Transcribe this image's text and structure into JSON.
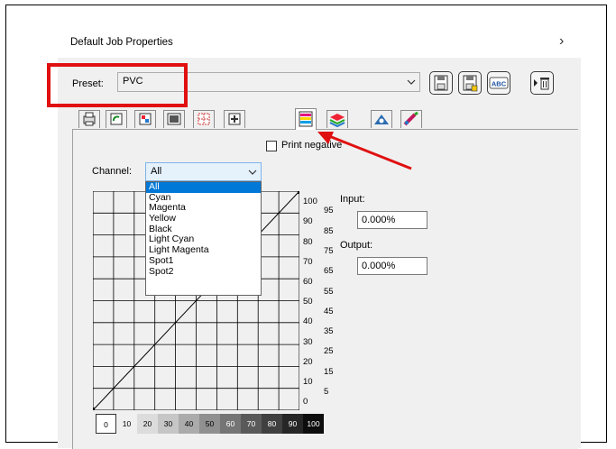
{
  "window": {
    "title": "Default Job Properties",
    "close_glyph": "›"
  },
  "preset": {
    "label": "Preset:",
    "value": "PVC"
  },
  "toolbar_icons": [
    "save-icon",
    "save-as-icon",
    "rename-icon",
    "delete-icon"
  ],
  "toolbar_labels": {
    "rename": "ABC"
  },
  "tabs": [
    "print-settings-icon",
    "rotate-icon",
    "color-icon",
    "layout-icon",
    "crop-marks-icon",
    "position-icon",
    "color-curve-icon",
    "layers-icon",
    "shape-icon",
    "color-picker-icon"
  ],
  "active_tab_index": 6,
  "print_negative": {
    "label": "Print negative",
    "checked": false
  },
  "channel": {
    "label": "Channel:",
    "value": "All",
    "options": [
      "All",
      "Cyan",
      "Magenta",
      "Yellow",
      "Black",
      "Light Cyan",
      "Light Magenta",
      "Spot1",
      "Spot2"
    ],
    "selected_index": 0
  },
  "graph_axis": {
    "left_ticks": [
      "100",
      "90",
      "80",
      "70",
      "60",
      "50",
      "40",
      "30",
      "20",
      "10",
      "0"
    ],
    "right_ticks": [
      "95",
      "85",
      "75",
      "65",
      "55",
      "45",
      "35",
      "25",
      "15",
      "5"
    ],
    "bottom_ticks": [
      "0",
      "10",
      "20",
      "30",
      "40",
      "50",
      "60",
      "70",
      "80",
      "90",
      "100"
    ]
  },
  "input": {
    "label": "Input:",
    "value": "0.000%"
  },
  "output": {
    "label": "Output:",
    "value": "0.000%"
  },
  "colors": {
    "annotation_red": "#e01010",
    "selection_blue": "#0078d7"
  }
}
